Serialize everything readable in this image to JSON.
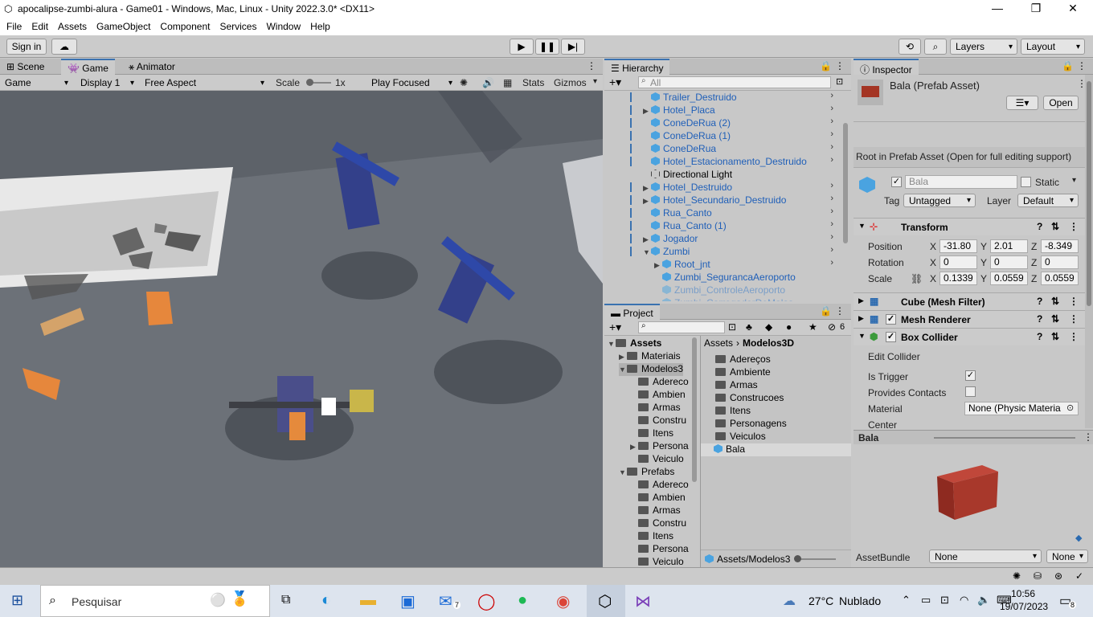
{
  "window": {
    "title": "apocalipse-zumbi-alura - Game01 - Windows, Mac, Linux - Unity 2022.3.0* <DX11>",
    "minimize": "—",
    "maximize": "❐",
    "close": "✕"
  },
  "menu": [
    "File",
    "Edit",
    "Assets",
    "GameObject",
    "Component",
    "Services",
    "Window",
    "Help"
  ],
  "toolbar": {
    "sign_in": "Sign in",
    "layers": "Layers",
    "layout": "Layout"
  },
  "game_panel": {
    "tabs": [
      "Scene",
      "Game",
      "Animator"
    ],
    "game_dropdown": "Game",
    "display": "Display 1",
    "aspect": "Free Aspect",
    "scale_label": "Scale",
    "scale_value": "1x",
    "play_focused": "Play Focused",
    "stats": "Stats",
    "gizmos": "Gizmos"
  },
  "hierarchy": {
    "title": "Hierarchy",
    "search_placeholder": "All",
    "items": [
      {
        "label": "Trailer_Destruido",
        "style": "blue",
        "indent": 0,
        "expand": ""
      },
      {
        "label": "Hotel_Placa",
        "style": "blue",
        "indent": 0,
        "expand": "▶"
      },
      {
        "label": "ConeDeRua (2)",
        "style": "blue",
        "indent": 0,
        "expand": ""
      },
      {
        "label": "ConeDeRua (1)",
        "style": "blue",
        "indent": 0,
        "expand": ""
      },
      {
        "label": "ConeDeRua",
        "style": "blue",
        "indent": 0,
        "expand": ""
      },
      {
        "label": "Hotel_Estacionamento_Destruido",
        "style": "blue",
        "indent": 0,
        "expand": ""
      },
      {
        "label": "Directional Light",
        "style": "normal",
        "indent": 0,
        "expand": ""
      },
      {
        "label": "Hotel_Destruido",
        "style": "blue",
        "indent": 0,
        "expand": "▶"
      },
      {
        "label": "Hotel_Secundario_Destruido",
        "style": "blue",
        "indent": 0,
        "expand": "▶"
      },
      {
        "label": "Rua_Canto",
        "style": "blue",
        "indent": 0,
        "expand": ""
      },
      {
        "label": "Rua_Canto (1)",
        "style": "blue",
        "indent": 0,
        "expand": ""
      },
      {
        "label": "Jogador",
        "style": "blue",
        "indent": 0,
        "expand": "▶"
      },
      {
        "label": "Zumbi",
        "style": "blue",
        "indent": 0,
        "expand": "▼"
      },
      {
        "label": "Root_jnt",
        "style": "blue",
        "indent": 1,
        "expand": "▶"
      },
      {
        "label": "Zumbi_SegurancaAeroporto",
        "style": "blue",
        "indent": 1,
        "expand": ""
      },
      {
        "label": "Zumbi_ControleAeroporto",
        "style": "grey",
        "indent": 1,
        "expand": ""
      },
      {
        "label": "Zumbi_CarregadorDeMalas",
        "style": "grey",
        "indent": 1,
        "expand": ""
      }
    ]
  },
  "project": {
    "title": "Project",
    "hidden_count": "6",
    "tree": [
      {
        "label": "Assets",
        "indent": 0,
        "expand": "▼",
        "bold": true
      },
      {
        "label": "Materiais",
        "indent": 1,
        "expand": "▶"
      },
      {
        "label": "Modelos3",
        "indent": 1,
        "expand": "▼"
      },
      {
        "label": "Adereco",
        "indent": 2,
        "expand": ""
      },
      {
        "label": "Ambien",
        "indent": 2,
        "expand": ""
      },
      {
        "label": "Armas",
        "indent": 2,
        "expand": ""
      },
      {
        "label": "Constru",
        "indent": 2,
        "expand": ""
      },
      {
        "label": "Itens",
        "indent": 2,
        "expand": ""
      },
      {
        "label": "Persona",
        "indent": 2,
        "expand": "▶"
      },
      {
        "label": "Veiculo",
        "indent": 2,
        "expand": ""
      },
      {
        "label": "Prefabs",
        "indent": 1,
        "expand": "▼"
      },
      {
        "label": "Adereco",
        "indent": 2,
        "expand": ""
      },
      {
        "label": "Ambien",
        "indent": 2,
        "expand": ""
      },
      {
        "label": "Armas",
        "indent": 2,
        "expand": ""
      },
      {
        "label": "Constru",
        "indent": 2,
        "expand": ""
      },
      {
        "label": "Itens",
        "indent": 2,
        "expand": ""
      },
      {
        "label": "Persona",
        "indent": 2,
        "expand": ""
      },
      {
        "label": "Veiculo",
        "indent": 2,
        "expand": ""
      }
    ],
    "breadcrumb": [
      "Assets",
      "Modelos3D"
    ],
    "files": [
      {
        "label": "Adereços",
        "type": "folder"
      },
      {
        "label": "Ambiente",
        "type": "folder"
      },
      {
        "label": "Armas",
        "type": "folder"
      },
      {
        "label": "Construcoes",
        "type": "folder"
      },
      {
        "label": "Itens",
        "type": "folder"
      },
      {
        "label": "Personagens",
        "type": "folder"
      },
      {
        "label": "Veiculos",
        "type": "folder"
      },
      {
        "label": "Bala",
        "type": "prefab"
      }
    ],
    "footer_path": "Assets/Modelos3"
  },
  "inspector": {
    "title": "Inspector",
    "asset_title": "Bala (Prefab Asset)",
    "open_button": "Open",
    "root_note": "Root in Prefab Asset (Open for full editing support)",
    "name": "Bala",
    "static_label": "Static",
    "tag_label": "Tag",
    "tag_value": "Untagged",
    "layer_label": "Layer",
    "layer_value": "Default",
    "transform": {
      "title": "Transform",
      "position_label": "Position",
      "position": [
        "-31.80",
        "2.01",
        "-8.349"
      ],
      "rotation_label": "Rotation",
      "rotation": [
        "0",
        "0",
        "0"
      ],
      "scale_label": "Scale",
      "scale": [
        "0.1339",
        "0.0559",
        "0.0559"
      ]
    },
    "mesh_filter": "Cube (Mesh Filter)",
    "mesh_renderer": "Mesh Renderer",
    "box_collider": {
      "title": "Box Collider",
      "edit_collider": "Edit Collider",
      "is_trigger_label": "Is Trigger",
      "provides_contacts_label": "Provides Contacts",
      "material_label": "Material",
      "material_value": "None (Physic Materia",
      "center_label": "Center"
    },
    "preview_title": "Bala",
    "assetbundle_label": "AssetBundle",
    "assetbundle_value": "None",
    "assetbundle_variant": "None"
  },
  "taskbar": {
    "search_placeholder": "Pesquisar",
    "weather_temp": "27°C",
    "weather_text": "Nublado",
    "mail_badge": "7",
    "notification_badge": "8",
    "time": "10:56",
    "date": "19/07/2023"
  },
  "colors": {
    "accent": "#3a72b0",
    "prefab_blue": "#1f5fb8",
    "game_ground": "#6b7078"
  }
}
